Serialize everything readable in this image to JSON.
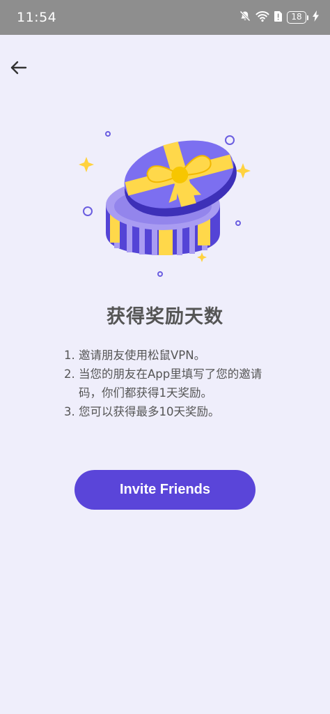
{
  "status_bar": {
    "time": "11:54",
    "battery_level": "18",
    "icons": [
      "bell-muted-icon",
      "wifi-icon",
      "sim-alert-icon",
      "battery-icon",
      "charging-bolt-icon"
    ]
  },
  "nav": {
    "back_icon": "arrow-left-icon"
  },
  "illustration": {
    "name": "gift-box-illustration",
    "colors": {
      "box_light": "#a99cf2",
      "box_dark": "#5444d6",
      "lid": "#7c6ff0",
      "ribbon": "#ffd84a",
      "sparkle": "#ffd23f"
    }
  },
  "main": {
    "title": "获得奖励天数",
    "steps": [
      {
        "num": "1.",
        "text": "邀请朋友使用松鼠VPN。"
      },
      {
        "num": "2.",
        "text": "当您的朋友在App里填写了您的邀请码，你们都获得1天奖励。"
      },
      {
        "num": "3.",
        "text": "您可以获得最多10天奖励。"
      }
    ],
    "invite_button_label": "Invite Friends"
  },
  "colors": {
    "background": "#efeefb",
    "accent": "#5a45d9",
    "status_bar": "#8e8e8e",
    "text": "#555555"
  }
}
